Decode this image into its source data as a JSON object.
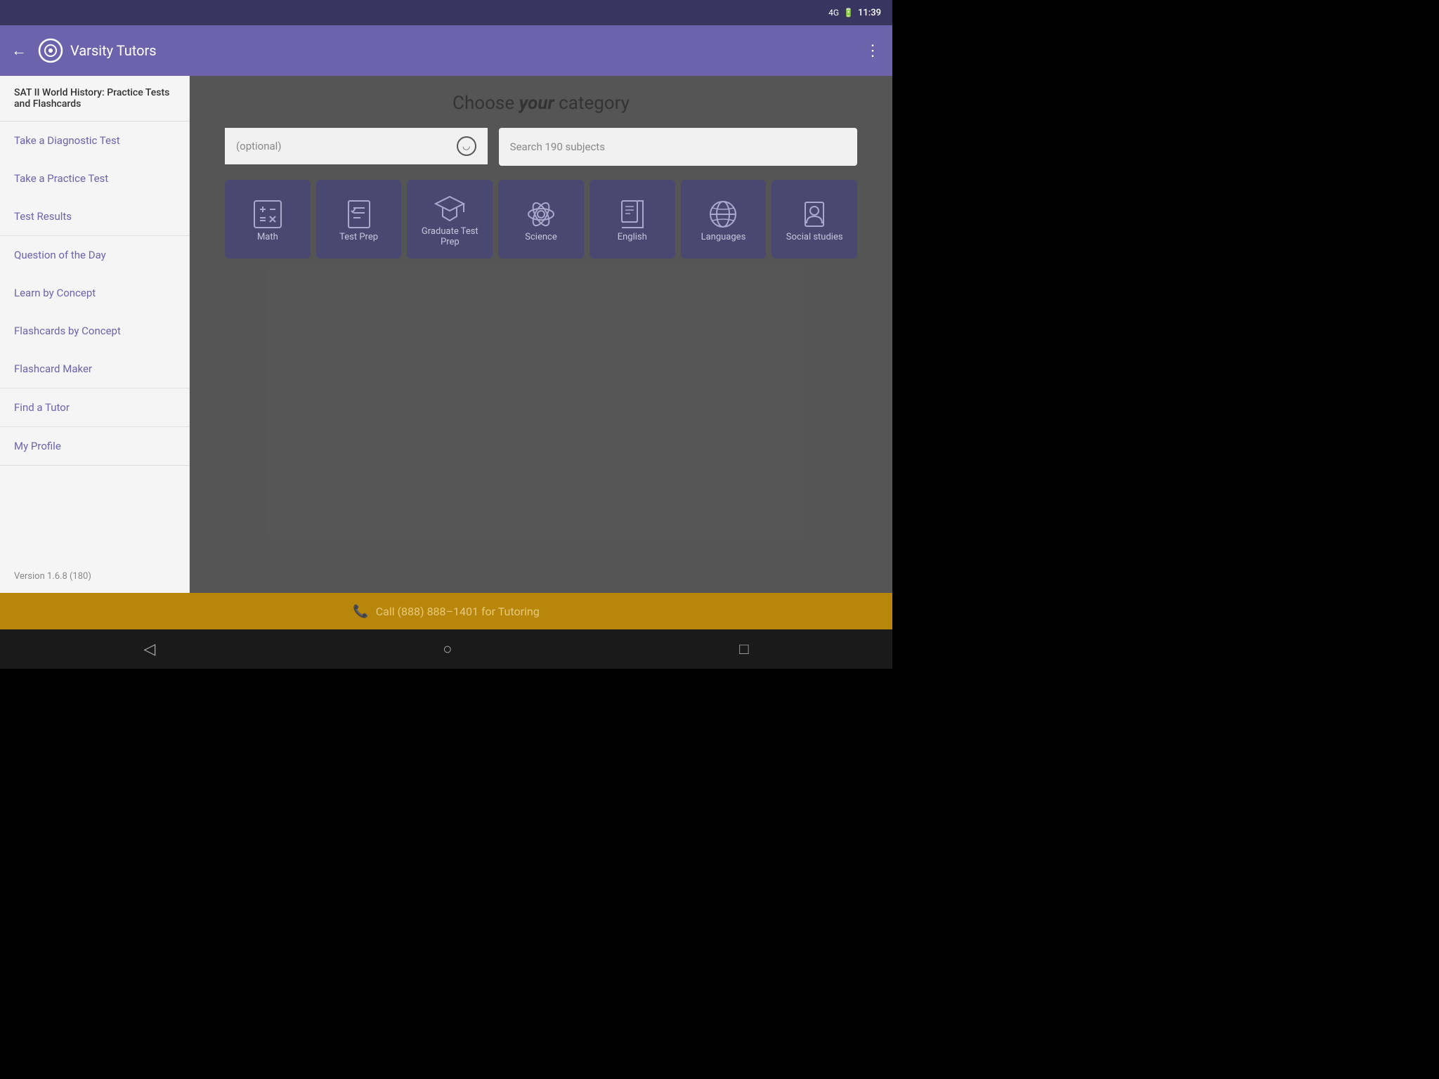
{
  "statusBar": {
    "network": "4G",
    "battery": "🔋",
    "time": "11:39"
  },
  "header": {
    "title": "Varsity Tutors",
    "backLabel": "←",
    "moreLabel": "⋮"
  },
  "sidebar": {
    "contextLabel": "SAT II World History: Practice Tests and Flashcards",
    "sections": [
      {
        "items": [
          {
            "label": "Take a Diagnostic Test"
          },
          {
            "label": "Take a Practice Test"
          },
          {
            "label": "Test Results"
          }
        ]
      },
      {
        "items": [
          {
            "label": "Question of the Day"
          },
          {
            "label": "Learn by Concept"
          },
          {
            "label": "Flashcards by Concept"
          },
          {
            "label": "Flashcard Maker"
          }
        ]
      },
      {
        "items": [
          {
            "label": "Find a Tutor"
          }
        ]
      },
      {
        "items": [
          {
            "label": "My Profile"
          }
        ]
      }
    ],
    "version": "Version 1.6.8 (180)"
  },
  "mainContent": {
    "title": "Choose ",
    "titleItalic": "your",
    "titleSuffix": " category",
    "searchOptionalPlaceholder": "(optional)",
    "searchSubjectsPlaceholder": "Search 190 subjects",
    "categories": [
      {
        "label": "Math",
        "icon": "math"
      },
      {
        "label": "Test Prep",
        "icon": "testprep"
      },
      {
        "label": "Graduate Test Prep",
        "icon": "gradtest"
      },
      {
        "label": "Science",
        "icon": "science"
      },
      {
        "label": "English",
        "icon": "english"
      },
      {
        "label": "Languages",
        "icon": "languages"
      },
      {
        "label": "Social studies",
        "icon": "social"
      }
    ]
  },
  "bottomBar": {
    "text": "Call (888) 888–1401 for Tutoring",
    "phoneIcon": "📞"
  },
  "navBar": {
    "back": "◁",
    "home": "○",
    "square": "□"
  }
}
